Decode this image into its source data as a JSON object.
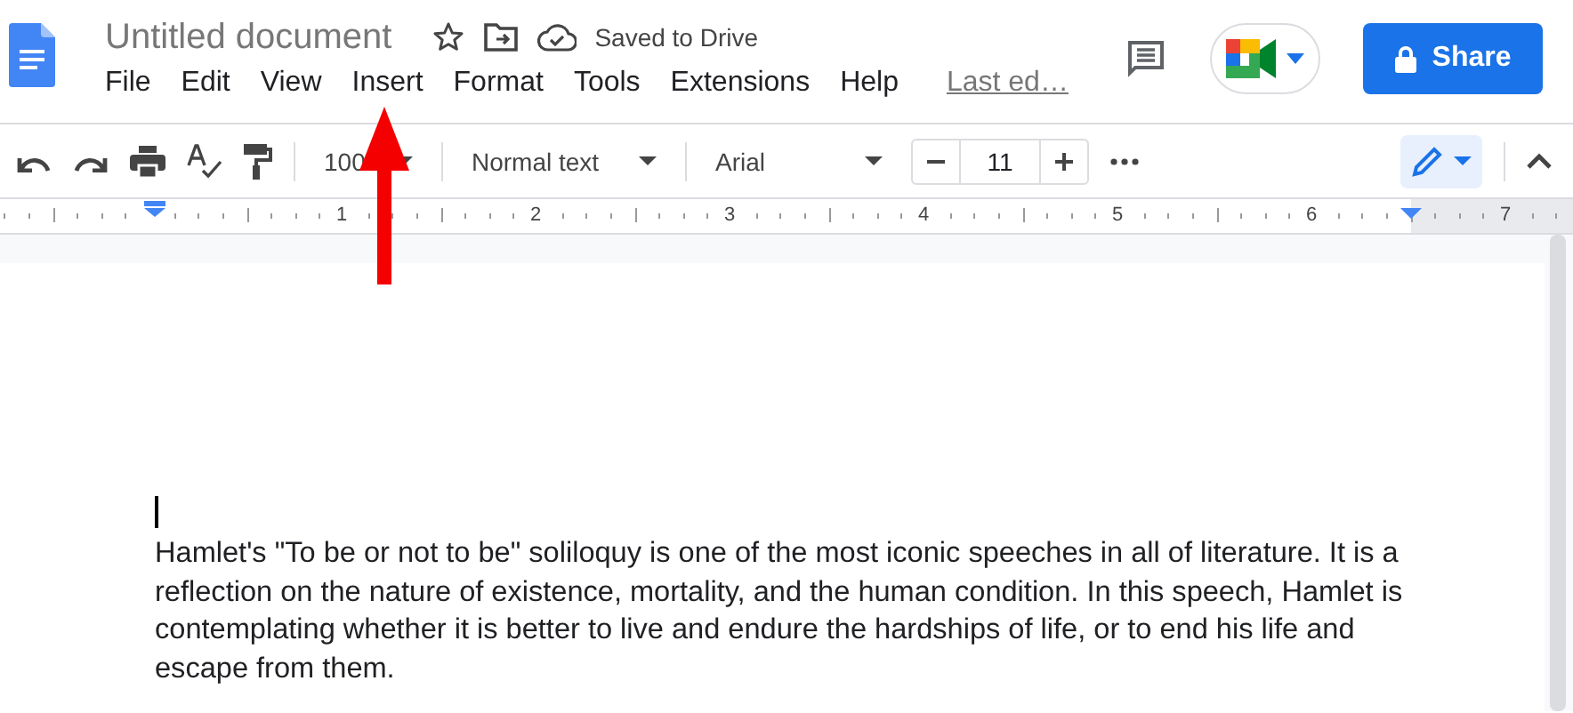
{
  "document_title": "Untitled document",
  "save_status": "Saved to Drive",
  "menu": [
    "File",
    "Edit",
    "View",
    "Insert",
    "Format",
    "Tools",
    "Extensions",
    "Help"
  ],
  "last_edit": "Last ed…",
  "share_button": "Share",
  "toolbar": {
    "zoom": "100",
    "paragraph_style": "Normal text",
    "font": "Arial",
    "font_size": "11"
  },
  "ruler": [
    "1",
    "2",
    "3",
    "4",
    "5",
    "6",
    "7"
  ],
  "body": "Hamlet's \"To be or not to be\" soliloquy is one of the most iconic speeches in all of literature. It is a reflection on the nature of existence, mortality, and the human condition. In this speech, Hamlet is contemplating whether it is better to live and endure the hardships of life, or to end his life and escape from them."
}
